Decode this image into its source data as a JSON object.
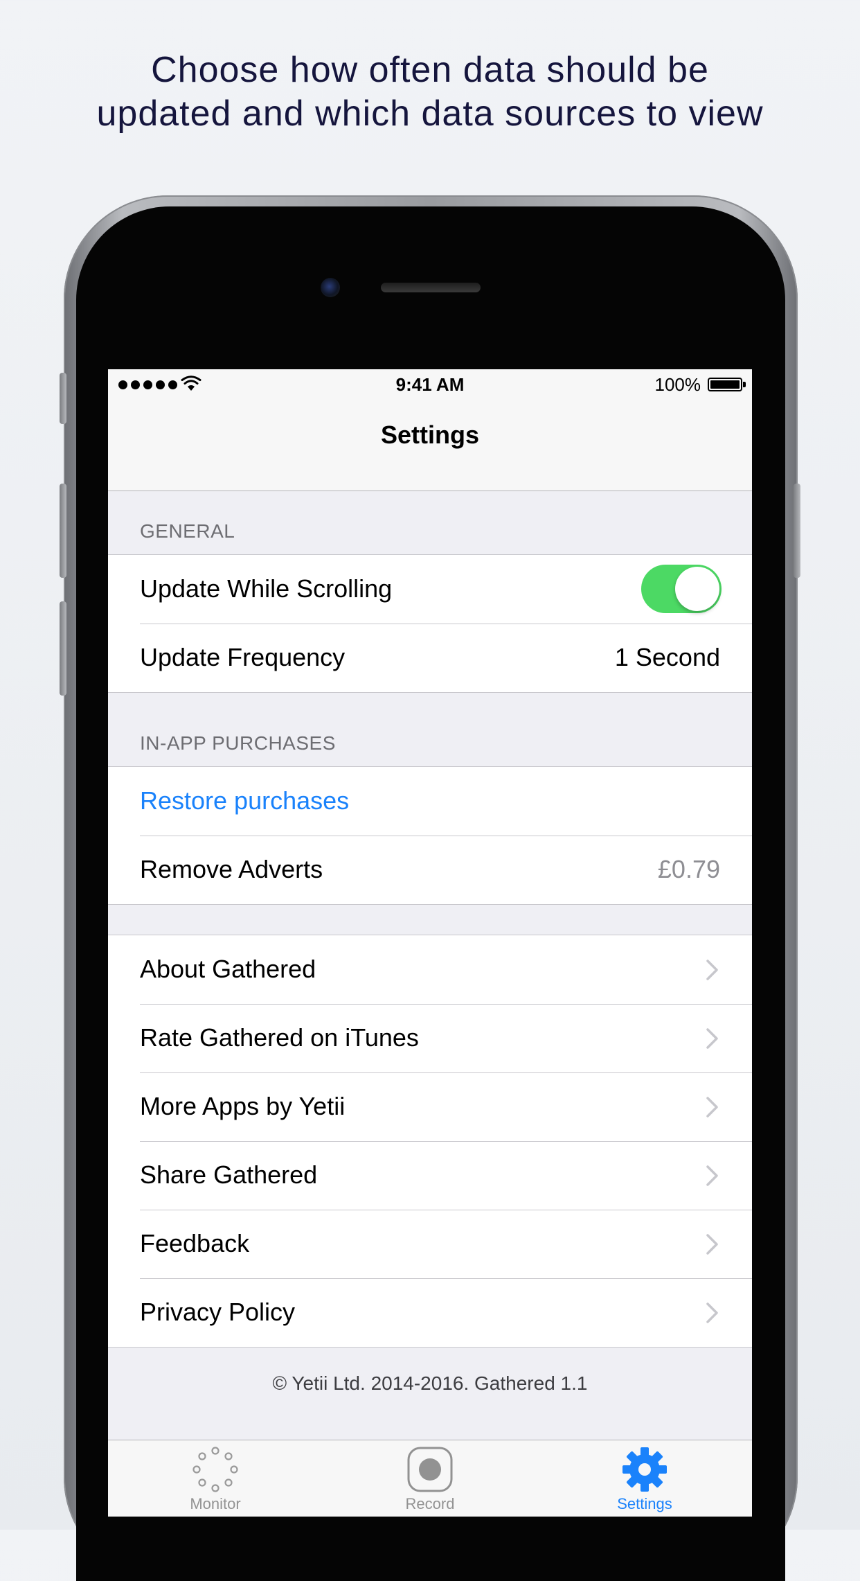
{
  "headline": {
    "line1": "Choose how often data should be",
    "line2": "updated and which data sources to view"
  },
  "status_bar": {
    "time": "9:41 AM",
    "battery": "100%",
    "signal_dots": 5
  },
  "nav": {
    "title": "Settings"
  },
  "sections": {
    "general": {
      "header": "GENERAL",
      "update_while_scrolling": {
        "label": "Update While Scrolling",
        "enabled": true
      },
      "update_frequency": {
        "label": "Update Frequency",
        "value": "1 Second"
      }
    },
    "purchases": {
      "header": "IN-APP PURCHASES",
      "restore": {
        "label": "Restore purchases"
      },
      "remove_adverts": {
        "label": "Remove Adverts",
        "price": "£0.79"
      }
    },
    "links": [
      {
        "label": "About Gathered"
      },
      {
        "label": "Rate Gathered on iTunes"
      },
      {
        "label": "More Apps by Yetii"
      },
      {
        "label": "Share Gathered"
      },
      {
        "label": "Feedback"
      },
      {
        "label": "Privacy Policy"
      }
    ]
  },
  "footer": "© Yetii Ltd. 2014-2016. Gathered 1.1",
  "tabs": {
    "monitor": {
      "label": "Monitor"
    },
    "record": {
      "label": "Record"
    },
    "settings": {
      "label": "Settings",
      "active": true
    }
  },
  "colors": {
    "accent": "#1a82fb",
    "toggle_on": "#4cd964",
    "headline": "#15153d"
  }
}
